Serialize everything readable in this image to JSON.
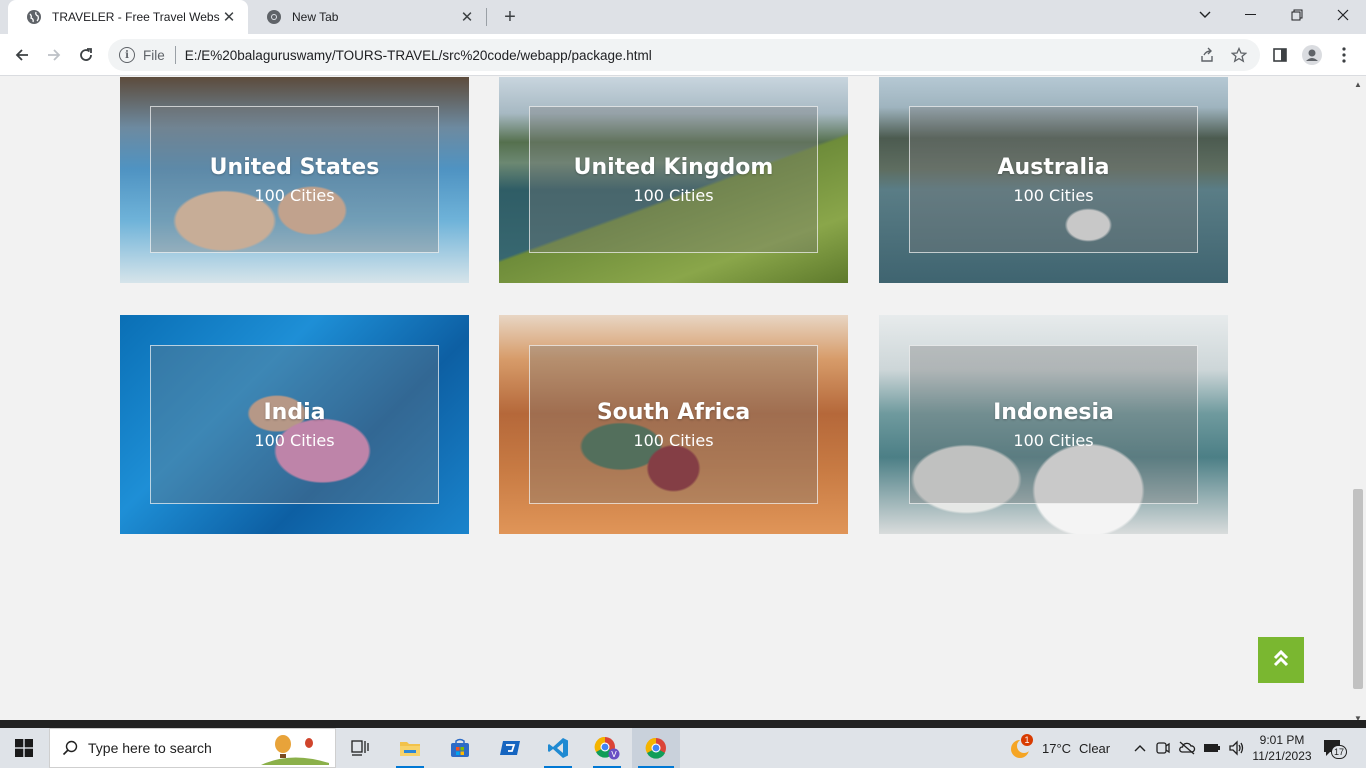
{
  "browser": {
    "tabs": [
      {
        "title": "TRAVELER - Free Travel Website",
        "active": true
      },
      {
        "title": "New Tab",
        "active": false
      }
    ],
    "address": {
      "scheme_label": "File",
      "url": "E:/E%20balaguruswamy/TOURS-TRAVEL/src%20code/webapp/package.html"
    }
  },
  "destinations": [
    {
      "country": "United States",
      "cities": "100 Cities"
    },
    {
      "country": "United Kingdom",
      "cities": "100 Cities"
    },
    {
      "country": "Australia",
      "cities": "100 Cities"
    },
    {
      "country": "India",
      "cities": "100 Cities"
    },
    {
      "country": "South Africa",
      "cities": "100 Cities"
    },
    {
      "country": "Indonesia",
      "cities": "100 Cities"
    }
  ],
  "colors": {
    "accent": "#7ab730",
    "page_bg": "#f2f2f2"
  },
  "taskbar": {
    "search_placeholder": "Type here to search",
    "weather": {
      "temp": "17°C",
      "condition": "Clear",
      "badge": "1"
    },
    "clock": {
      "time": "9:01 PM",
      "date": "11/21/2023"
    },
    "notification_count": "17"
  }
}
